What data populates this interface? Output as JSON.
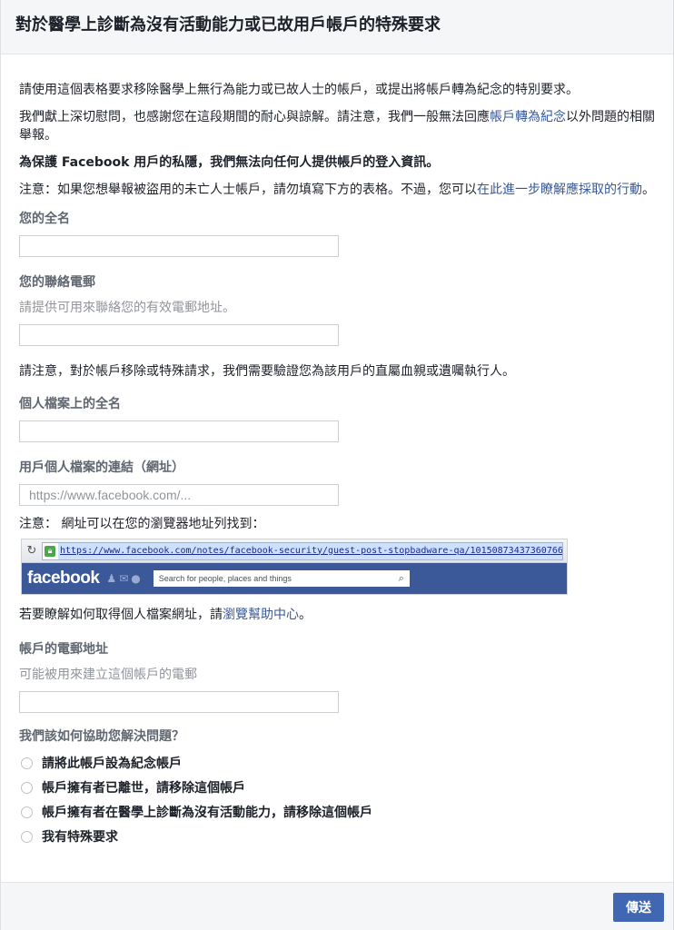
{
  "page": {
    "title": "對於醫學上診斷為沒有活動能力或已故用戶帳戶的特殊要求"
  },
  "intro": {
    "p1": "請使用這個表格要求移除醫學上無行為能力或已故人士的帳戶，或提出將帳戶轉為紀念的特別要求。",
    "p2_before": "我們獻上深切慰問，也感謝您在這段期間的耐心與諒解。請注意，我們一般無法回應",
    "p2_link": "帳戶轉為紀念",
    "p2_after": "以外問題的相關舉報。",
    "p3": "為保護 Facebook 用戶的私隱，我們無法向任何人提供帳戶的登入資訊。",
    "p4_before": "注意：如果您想舉報被盜用的未亡人士帳戶，請勿填寫下方的表格。不過，您可以",
    "p4_link": "在此進一步瞭解應採取的行動",
    "p4_after": "。"
  },
  "fields": {
    "full_name_label": "您的全名",
    "contact_email_label": "您的聯絡電郵",
    "contact_email_hint": "請提供可用來聯絡您的有效電郵地址。",
    "verify_note": "請注意，對於帳戶移除或特殊請求，我們需要驗證您為該用戶的直屬血親或遺囑執行人。",
    "profile_name_label": "個人檔案上的全名",
    "profile_url_label": "用戶個人檔案的連結（網址）",
    "profile_url_placeholder": "https://www.facebook.com/...",
    "url_note": "注意： 網址可以在您的瀏覽器地址列找到：",
    "help_before": "若要瞭解如何取得個人檔案網址，請",
    "help_link": "瀏覽幫助中心",
    "help_after": "。",
    "account_email_label": "帳戶的電郵地址",
    "account_email_hint": "可能被用來建立這個帳戶的電郵"
  },
  "browser_example": {
    "url": "https://www.facebook.com/notes/facebook-security/guest-post-stopbadware-qa/10150873437360766",
    "logo": "facebook",
    "search_placeholder": "Search for people, places and things"
  },
  "question": {
    "label": "我們該如何協助您解決問題？",
    "options": [
      "請將此帳戶設為紀念帳戶",
      "帳戶擁有者已離世，請移除這個帳戶",
      "帳戶擁有者在醫學上診斷為沒有活動能力，請移除這個帳戶",
      "我有特殊要求"
    ]
  },
  "footer": {
    "send_label": "傳送"
  },
  "colors": {
    "link": "#365899",
    "button": "#4267b2",
    "fb_blue": "#3b5998"
  }
}
